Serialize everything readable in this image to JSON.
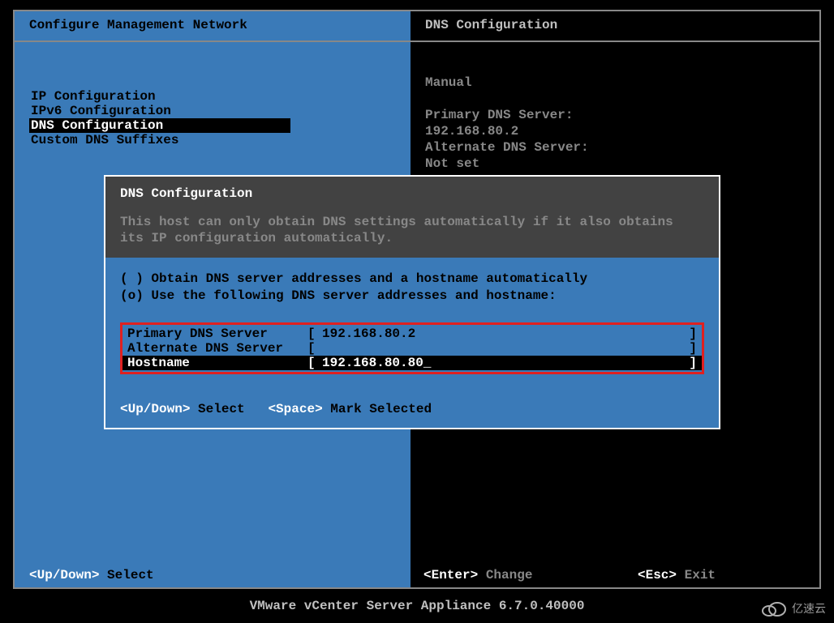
{
  "header": {
    "left_title": "Configure Management Network",
    "right_title": "DNS Configuration"
  },
  "menu": {
    "items": [
      {
        "label": "IP Configuration",
        "selected": false
      },
      {
        "label": "IPv6 Configuration",
        "selected": false
      },
      {
        "label": "DNS Configuration",
        "selected": true
      },
      {
        "label": "Custom DNS Suffixes",
        "selected": false
      }
    ]
  },
  "info": {
    "mode": "Manual",
    "primary_label": "Primary DNS Server:",
    "primary_value": "192.168.80.2",
    "alternate_label": "Alternate DNS Server:",
    "alternate_value": "Not set"
  },
  "modal": {
    "title": "DNS Configuration",
    "subtitle": "This host can only obtain DNS settings automatically if it also obtains its IP configuration automatically.",
    "options": {
      "auto": "( ) Obtain DNS server addresses and a hostname automatically",
      "manual": "(o) Use the following DNS server addresses and hostname:"
    },
    "fields": {
      "primary": {
        "label": "Primary DNS Server",
        "value": "192.168.80.2"
      },
      "alternate": {
        "label": "Alternate DNS Server",
        "value": ""
      },
      "hostname": {
        "label": "Hostname",
        "value": "192.168.80.80"
      }
    },
    "footer": {
      "updown_key": "<Up/Down>",
      "updown_label": "Select",
      "space_key": "<Space>",
      "space_label": "Mark Selected"
    }
  },
  "hints": {
    "updown_key": "<Up/Down>",
    "updown_label": "Select",
    "enter_key": "<Enter>",
    "enter_label": "Change",
    "esc_key": "<Esc>",
    "esc_label": "Exit"
  },
  "product": "VMware vCenter Server Appliance 6.7.0.40000",
  "watermark": "亿速云"
}
